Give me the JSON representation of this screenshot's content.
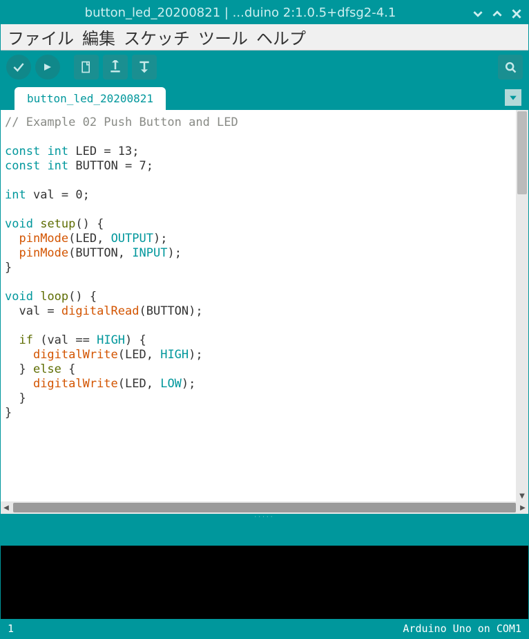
{
  "title": "button_led_20200821 | ...duino 2:1.0.5+dfsg2-4.1",
  "menu": {
    "file": "ファイル",
    "edit": "編集",
    "sketch": "スケッチ",
    "tools": "ツール",
    "help": "ヘルプ"
  },
  "tab": {
    "label": "button_led_20200821"
  },
  "footer": {
    "line": "1",
    "board": "Arduino Uno on COM1"
  },
  "code": {
    "l1_comment": "// Example 02 Push Button and LED",
    "l2": "",
    "l3_a": "const",
    "l3_b": "int",
    "l3_c": " LED = 13;",
    "l4_a": "const",
    "l4_b": "int",
    "l4_c": " BUTTON = 7;",
    "l5": "",
    "l6_a": "int",
    "l6_b": " val = 0;",
    "l7": "",
    "l8_a": "void",
    "l8_b": "setup",
    "l8_c": "() {",
    "l9_a": "  ",
    "l9_b": "pinMode",
    "l9_c": "(LED, ",
    "l9_d": "OUTPUT",
    "l9_e": ");",
    "l10_a": "  ",
    "l10_b": "pinMode",
    "l10_c": "(BUTTON, ",
    "l10_d": "INPUT",
    "l10_e": ");",
    "l11": "}",
    "l12": "",
    "l13_a": "void",
    "l13_b": "loop",
    "l13_c": "() {",
    "l14_a": "  val = ",
    "l14_b": "digitalRead",
    "l14_c": "(BUTTON);",
    "l15": "",
    "l16_a": "  ",
    "l16_b": "if",
    "l16_c": " (val == ",
    "l16_d": "HIGH",
    "l16_e": ") {",
    "l17_a": "    ",
    "l17_b": "digitalWrite",
    "l17_c": "(LED, ",
    "l17_d": "HIGH",
    "l17_e": ");",
    "l18_a": "  } ",
    "l18_b": "else",
    "l18_c": " {",
    "l19_a": "    ",
    "l19_b": "digitalWrite",
    "l19_c": "(LED, ",
    "l19_d": "LOW",
    "l19_e": ");",
    "l20": "  }",
    "l21": "}"
  }
}
